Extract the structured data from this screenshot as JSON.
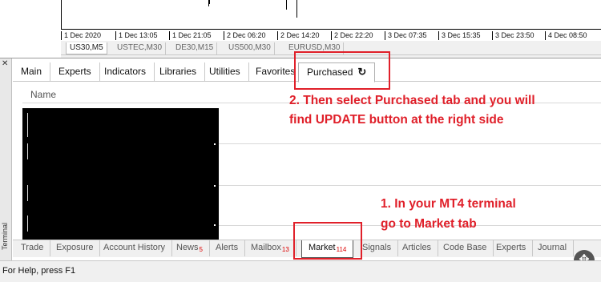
{
  "chart": {
    "time_labels": [
      "1 Dec 2020",
      "1 Dec 13:05",
      "1 Dec 21:05",
      "2 Dec 06:20",
      "2 Dec 14:20",
      "2 Dec 22:20",
      "3 Dec 07:35",
      "3 Dec 15:35",
      "3 Dec 23:50",
      "4 Dec 08:50"
    ],
    "symbol_tabs": [
      "US30,M5",
      "USTEC,M30",
      "DE30,M15",
      "US500,M30",
      "EURUSD,M30"
    ]
  },
  "terminal": {
    "side_label": "Terminal",
    "close_label": "✕",
    "market_tabs": [
      "Main",
      "Experts",
      "Indicators",
      "Libraries",
      "Utilities",
      "Favorites",
      "Purchased"
    ],
    "refresh_icon": "↻",
    "list_header": "Name",
    "bottom_tabs": [
      {
        "label": "Trade",
        "badge": ""
      },
      {
        "label": "Exposure",
        "badge": ""
      },
      {
        "label": "Account History",
        "badge": ""
      },
      {
        "label": "News",
        "badge": "5"
      },
      {
        "label": "Alerts",
        "badge": ""
      },
      {
        "label": "Mailbox",
        "badge": "13"
      },
      {
        "label": "Market",
        "badge": "114"
      },
      {
        "label": "Signals",
        "badge": ""
      },
      {
        "label": "Articles",
        "badge": ""
      },
      {
        "label": "Code Base",
        "badge": ""
      },
      {
        "label": "Experts",
        "badge": ""
      },
      {
        "label": "Journal",
        "badge": ""
      }
    ]
  },
  "status_bar": {
    "help_text": "For Help, press F1"
  },
  "annotations": {
    "step1_line1": "1. In your MT4 terminal",
    "step1_line2": "go to Market tab",
    "step2_line1": "2. Then select Purchased tab and you will",
    "step2_line2": "find UPDATE button at the right side"
  },
  "colors": {
    "annotation": "#e0202a"
  },
  "icons": {
    "drag": "move-arrows-icon"
  }
}
